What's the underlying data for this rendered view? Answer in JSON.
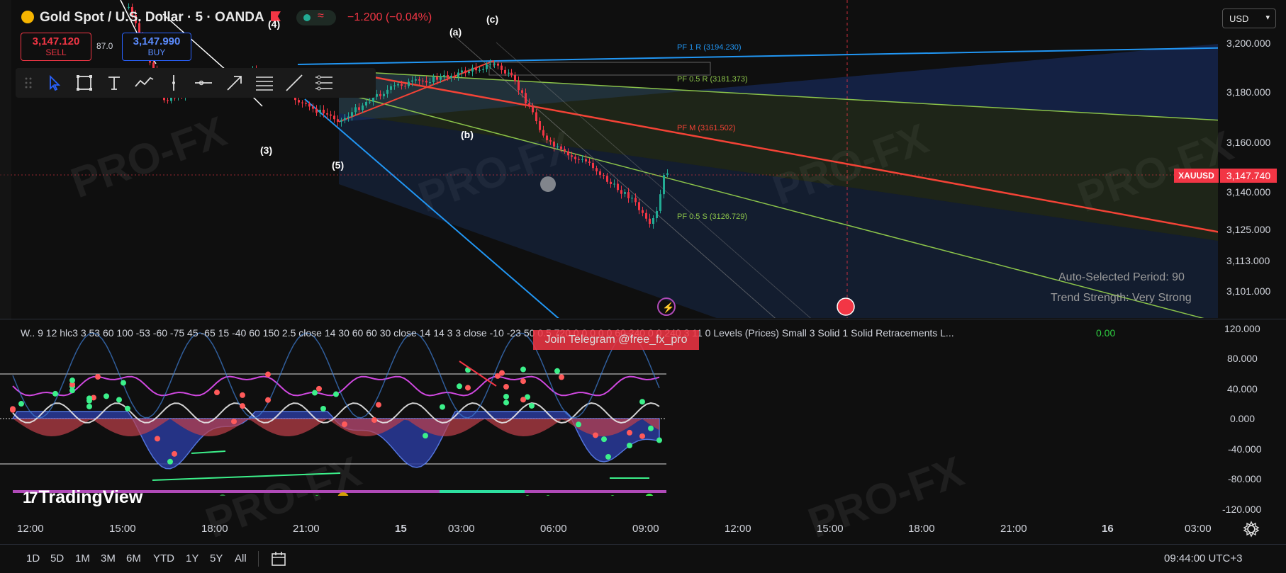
{
  "header": {
    "symbol_title": "Gold Spot / U.S. Dollar · 5 · OANDA",
    "change": "−1.200 (−0.04%)",
    "status_wave": "≈"
  },
  "trade": {
    "sell_price": "3,147.120",
    "sell_label": "SELL",
    "spread": "87.0",
    "buy_price": "3,147.990",
    "buy_label": "BUY"
  },
  "currency_button": "USD",
  "price_axis": [
    "3,200.000",
    "3,180.000",
    "3,160.000",
    "3,140.000",
    "3,125.000",
    "3,113.000",
    "3,101.000"
  ],
  "last_price": {
    "symbol": "XAUUSD",
    "value": "3,147.740"
  },
  "pivot_labels": {
    "r1": "PF 1 R (3194.230)",
    "r05": "PF 0.5 R (3181.373)",
    "m": "PF M (3161.502)",
    "s05": "PF 0.5 S (3126.729)"
  },
  "wave_labels": {
    "a": "(a)",
    "b": "(b)",
    "c": "(c)",
    "w3": "(3)",
    "w4": "(4)",
    "w5": "(5)"
  },
  "info": {
    "period": "Auto-Selected Period: 90",
    "strength": "Trend Strength: Very Strong"
  },
  "indicator": {
    "label": "W.. 9 12 hlc3 3 53 60 100 -53 -60 -75 45 -65 15 -40 60 150 2.5 close 14 30 60 60 30 close 14 14 3 3 close -10 -23 50 0.5 720 0 0 0 0 0 60 240 0 0 240 3 11 0 Levels (Prices) Small 3 Solid 1 Solid Retracements L...",
    "value": "0.00",
    "axis": [
      "120.000",
      "80.000",
      "40.000",
      "0.000",
      "-40.000",
      "-80.000",
      "-120.000"
    ]
  },
  "telegram_banner": "Join Telegram @free_fx_pro",
  "branding": {
    "logo_mark": "17",
    "logo_text": "TradingView"
  },
  "time_axis": [
    "12:00",
    "15:00",
    "18:00",
    "21:00",
    "15",
    "03:00",
    "06:00",
    "09:00",
    "12:00",
    "15:00",
    "18:00",
    "21:00",
    "16",
    "03:00"
  ],
  "ranges": [
    "1D",
    "5D",
    "1M",
    "3M",
    "6M",
    "YTD",
    "1Y",
    "5Y",
    "All"
  ],
  "clock": "09:44:00 UTC+3",
  "colors": {
    "down": "#f23645",
    "up": "#22ab94",
    "blue": "#2962ff",
    "pivot_r": "#2196f3",
    "pivot_green": "#8bc34a"
  }
}
